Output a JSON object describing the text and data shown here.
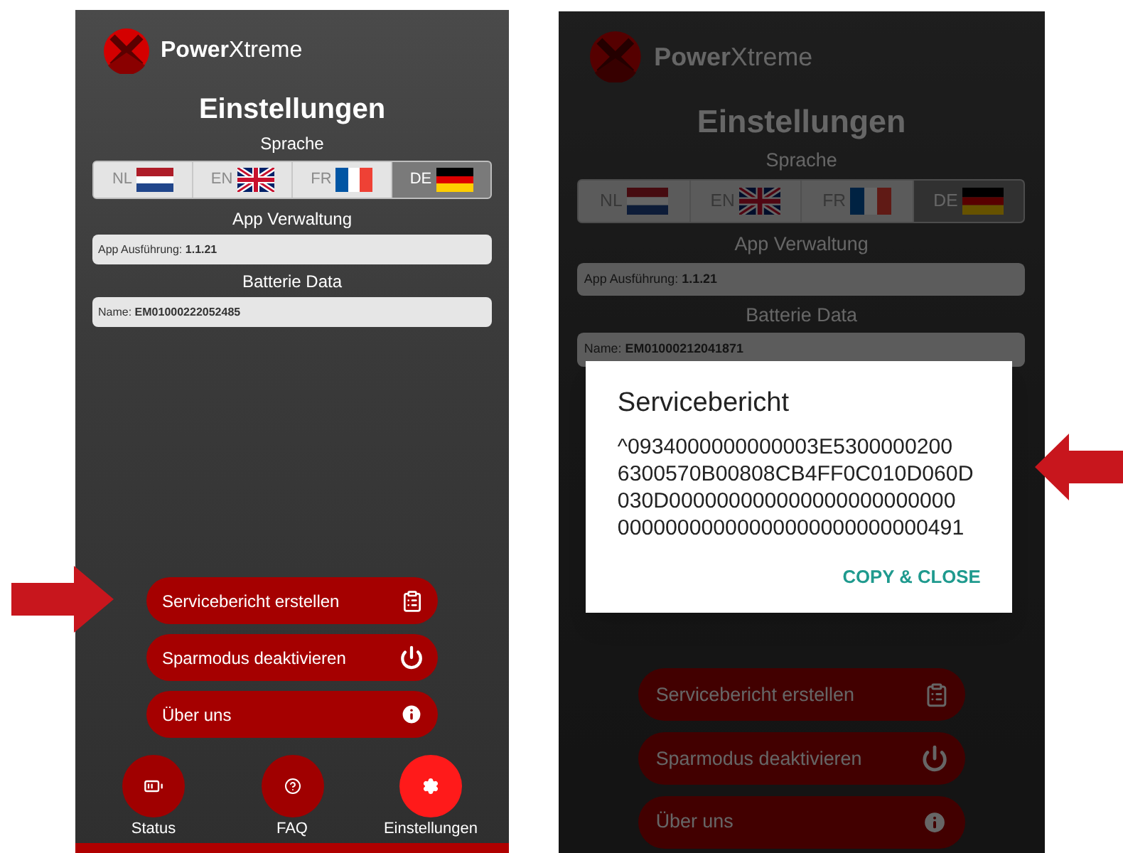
{
  "screens": [
    {
      "brand": {
        "bold": "Power",
        "light": "Xtreme"
      },
      "title": "Einstellungen",
      "language_label": "Sprache",
      "languages": [
        {
          "code": "NL",
          "selected": false
        },
        {
          "code": "EN",
          "selected": false
        },
        {
          "code": "FR",
          "selected": false
        },
        {
          "code": "DE",
          "selected": true
        }
      ],
      "app_label": "App Verwaltung",
      "app_field": {
        "label": "App Ausführung:",
        "value": "1.1.21"
      },
      "battery_label": "Batterie Data",
      "battery_field": {
        "label": "Name:",
        "value": "EM01000222052485"
      },
      "actions": [
        {
          "label": "Servicebericht erstellen"
        },
        {
          "label": "Sparmodus deaktivieren"
        },
        {
          "label": "Über uns"
        }
      ],
      "nav": [
        {
          "label": "Status",
          "selected": false
        },
        {
          "label": "FAQ",
          "selected": false
        },
        {
          "label": "Einstellungen",
          "selected": true
        }
      ],
      "dimmed": false
    },
    {
      "brand": {
        "bold": "Power",
        "light": "Xtreme"
      },
      "title": "Einstellungen",
      "language_label": "Sprache",
      "languages": [
        {
          "code": "NL",
          "selected": false
        },
        {
          "code": "EN",
          "selected": false
        },
        {
          "code": "FR",
          "selected": false
        },
        {
          "code": "DE",
          "selected": true
        }
      ],
      "app_label": "App Verwaltung",
      "app_field": {
        "label": "App Ausführung:",
        "value": "1.1.21"
      },
      "battery_label": "Batterie Data",
      "battery_field": {
        "label": "Name:",
        "value": "EM01000212041871"
      },
      "actions": [
        {
          "label": "Servicebericht erstellen"
        },
        {
          "label": "Sparmodus deaktivieren"
        },
        {
          "label": "Über uns"
        }
      ],
      "dimmed": true,
      "dialog": {
        "title": "Servicebericht",
        "lines": [
          "^0934000000000003E5300000200",
          "6300570B00808CB4FF0C010D060D",
          "030D000000000000000000000000",
          "00000000000000000000000000491"
        ],
        "button": "COPY & CLOSE"
      }
    }
  ]
}
